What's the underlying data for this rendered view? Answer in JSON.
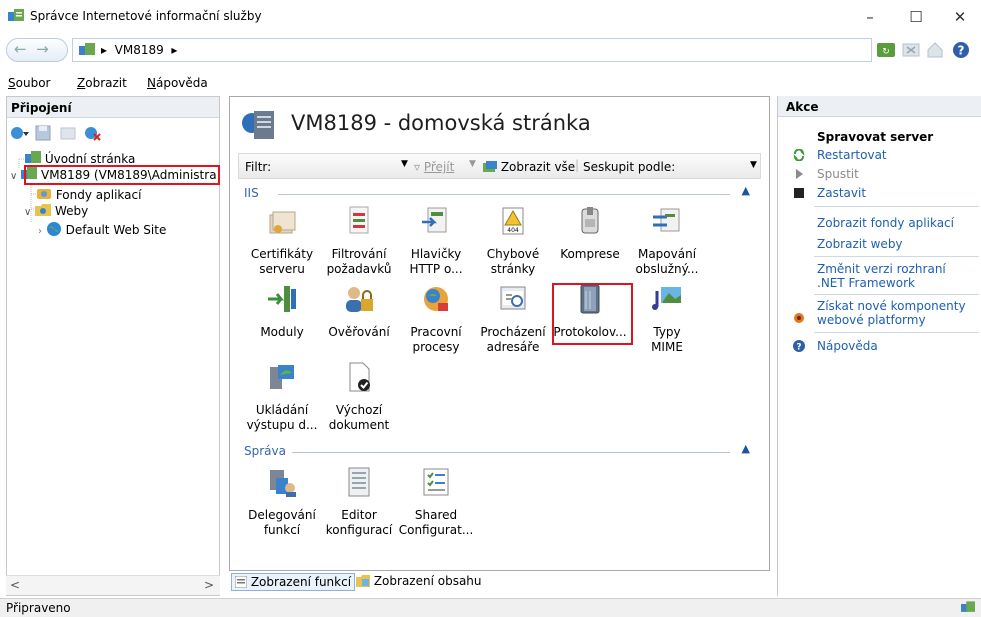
{
  "window": {
    "title": "Správce Internetové informační služby",
    "controls": [
      "minimize-icon",
      "maximize-icon",
      "close-icon"
    ]
  },
  "address": {
    "segments": [
      "VM8189"
    ]
  },
  "menu": {
    "items": [
      {
        "label": "Soubor"
      },
      {
        "label": "Zobrazit"
      },
      {
        "label": "Nápověda"
      }
    ]
  },
  "connections": {
    "header": "Připojení",
    "tree": [
      {
        "label": "Úvodní stránka",
        "icon": "home-server-icon"
      },
      {
        "label": "VM8189 (VM8189\\Administra",
        "icon": "server-icon",
        "highlighted": true
      },
      {
        "label": "Fondy aplikací",
        "icon": "app-pools-icon"
      },
      {
        "label": "Weby",
        "icon": "sites-folder-icon"
      },
      {
        "label": "Default Web Site",
        "icon": "globe-icon"
      }
    ]
  },
  "center": {
    "title": "VM8189 - domovská stránka",
    "filter": {
      "label": "Filtr:",
      "go_label": "Přejít",
      "show_all_label": "Zobrazit vše",
      "group_by_label": "Seskupit podle:"
    },
    "groups": [
      {
        "name": "IIS",
        "features": [
          {
            "label": "Certifikáty serveru",
            "icon": "certificates-icon"
          },
          {
            "label": "Filtrování požadavků",
            "icon": "request-filtering-icon"
          },
          {
            "label": "Hlavičky HTTP o...",
            "icon": "http-headers-icon"
          },
          {
            "label": "Chybové stránky",
            "icon": "error-pages-icon"
          },
          {
            "label": "Komprese",
            "icon": "compression-icon"
          },
          {
            "label": "Mapování obslužný...",
            "icon": "handler-mappings-icon"
          },
          {
            "label": "Moduly",
            "icon": "modules-icon"
          },
          {
            "label": "Ověřování",
            "icon": "authentication-icon"
          },
          {
            "label": "Pracovní procesy",
            "icon": "worker-processes-icon"
          },
          {
            "label": "Procházení adresáře",
            "icon": "directory-browsing-icon"
          },
          {
            "label": "Protokolov...",
            "icon": "logging-icon",
            "highlighted": true
          },
          {
            "label": "Typy MIME",
            "icon": "mime-types-icon"
          },
          {
            "label": "Ukládání výstupu d...",
            "icon": "output-caching-icon"
          },
          {
            "label": "Výchozí dokument",
            "icon": "default-document-icon"
          }
        ]
      },
      {
        "name": "Správa",
        "features": [
          {
            "label": "Delegování funkcí",
            "icon": "feature-delegation-icon"
          },
          {
            "label": "Editor konfigurací",
            "icon": "configuration-editor-icon"
          },
          {
            "label": "Shared Configurat...",
            "icon": "shared-configuration-icon"
          }
        ]
      }
    ],
    "tabs": {
      "features_view": "Zobrazení funkcí",
      "content_view": "Zobrazení obsahu"
    }
  },
  "actions": {
    "header": "Akce",
    "manage_server": "Spravovat server",
    "items": [
      {
        "label": "Restartovat",
        "icon": "restart-icon",
        "disabled": false
      },
      {
        "label": "Spustit",
        "icon": "start-icon",
        "disabled": true
      },
      {
        "label": "Zastavit",
        "icon": "stop-icon",
        "disabled": false
      },
      {
        "label": "Zobrazit fondy aplikací",
        "disabled": false
      },
      {
        "label": "Zobrazit weby",
        "disabled": false
      },
      {
        "label": "Změnit verzi rozhraní .NET Framework",
        "disabled": false
      },
      {
        "label": "Získat nové komponenty webové platformy",
        "icon": "web-platform-icon",
        "disabled": false
      },
      {
        "label": "Nápověda",
        "icon": "help-icon",
        "disabled": false
      }
    ]
  },
  "status": {
    "text": "Připraveno"
  },
  "colors": {
    "highlight": "#e0141e",
    "link": "#1e5fb4",
    "group": "#3466b0"
  }
}
